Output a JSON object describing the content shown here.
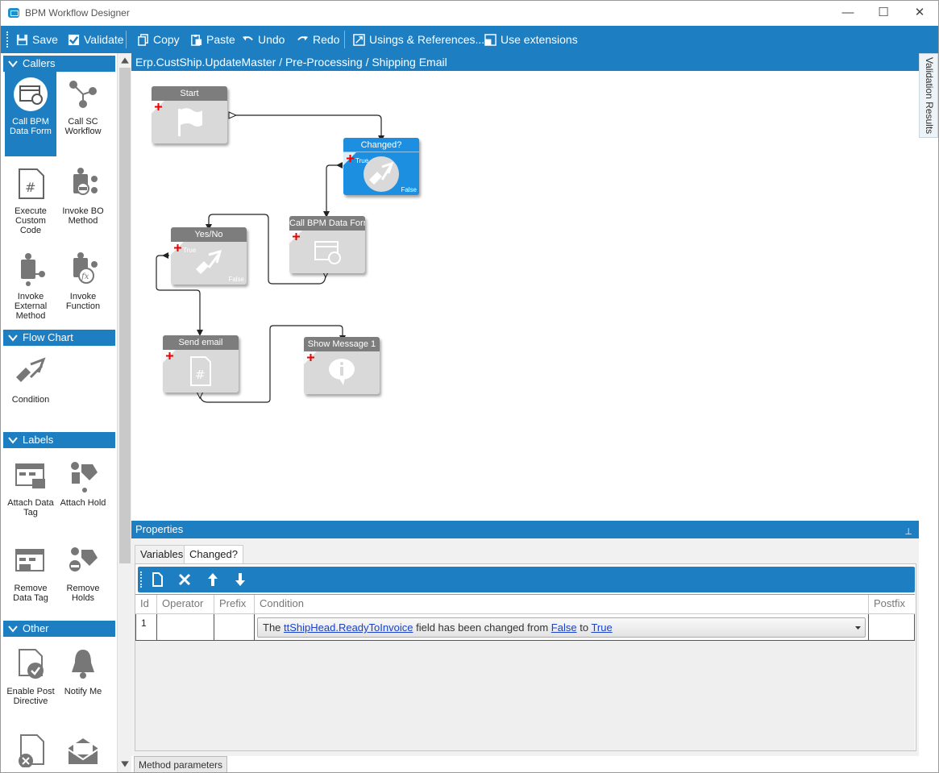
{
  "window": {
    "title": "BPM Workflow Designer",
    "controls": {
      "minimize": "—",
      "maximize": "☐",
      "close": "✕"
    }
  },
  "toolbar": {
    "save": "Save",
    "validate": "Validate",
    "copy": "Copy",
    "paste": "Paste",
    "undo": "Undo",
    "redo": "Redo",
    "usings": "Usings & References...",
    "extensions": "Use extensions"
  },
  "toolbox": {
    "callers": {
      "header": "Callers",
      "items": [
        "Call BPM Data Form",
        "Call SC Workflow",
        "Execute Custom Code",
        "Invoke BO Method",
        "Invoke External Method",
        "Invoke Function"
      ]
    },
    "flow_chart": {
      "header": "Flow Chart",
      "items": [
        "Condition"
      ]
    },
    "labels": {
      "header": "Labels",
      "items": [
        "Attach Data Tag",
        "Attach Hold",
        "Remove Data Tag",
        "Remove Holds"
      ]
    },
    "other": {
      "header": "Other",
      "items": [
        "Enable Post Directive",
        "Notify Me"
      ]
    }
  },
  "breadcrumb": "Erp.CustShip.UpdateMaster / Pre-Processing / Shipping Email",
  "validation_tab": "Validation Results",
  "nodes": {
    "start": "Start",
    "changed": "Changed?",
    "call_bpm": "Call BPM Data Forr",
    "yes_no": "Yes/No",
    "send_email": "Send email",
    "show_message": "Show Message 1",
    "true_label": "True",
    "false_label": "False"
  },
  "properties": {
    "header": "Properties",
    "tabs": [
      "Variables",
      "Changed?"
    ],
    "columns": [
      "Id",
      "Operator",
      "Prefix",
      "Condition",
      "Postfix"
    ],
    "row": {
      "id": "1",
      "operator": "",
      "prefix": "",
      "condition_prefix": "The",
      "condition_field": "ttShipHead.ReadyToInvoice",
      "condition_mid": "field has been changed from",
      "condition_from": "False",
      "condition_to_word": "to",
      "condition_to": "True",
      "postfix": ""
    }
  },
  "bottom_tab": "Method parameters",
  "colors": {
    "accent": "#1d7ec2",
    "active_node": "#1d8fe0",
    "node": "#d9d9d9",
    "node_header": "#7d7d7d"
  }
}
